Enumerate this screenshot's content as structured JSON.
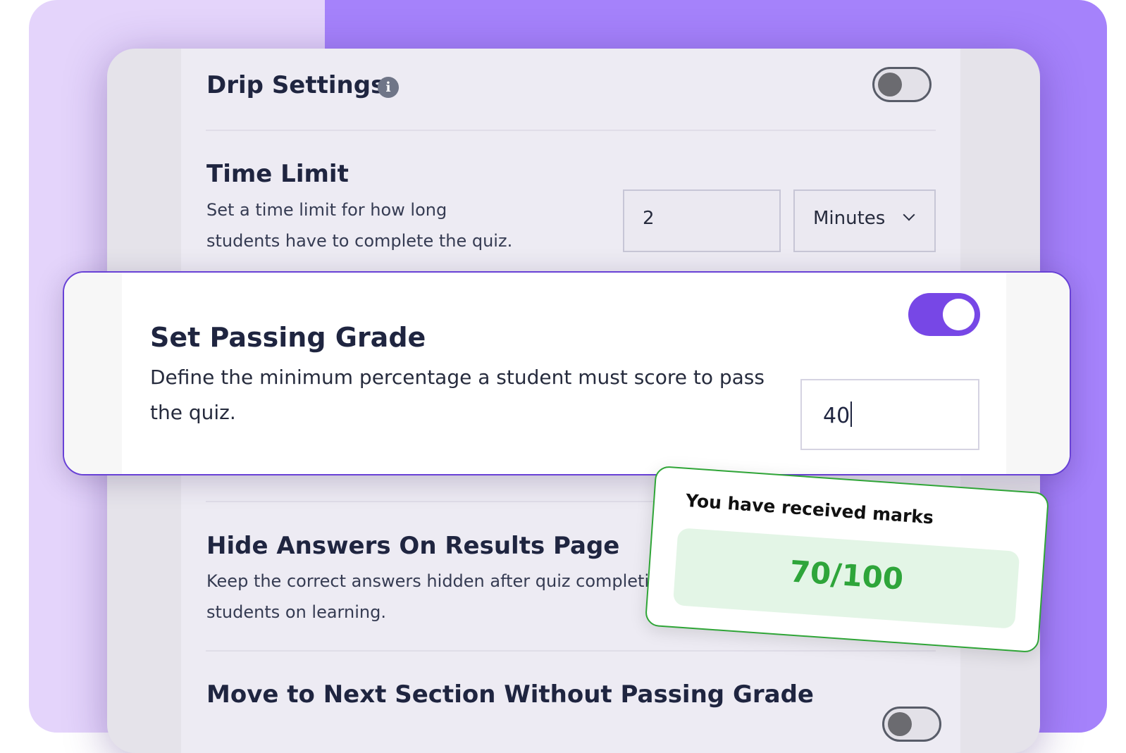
{
  "drip": {
    "title": "Drip Settings",
    "info_icon": "info-icon",
    "enabled": false
  },
  "time_limit": {
    "title": "Time Limit",
    "description": "Set a time limit for how long students have to complete the quiz.",
    "value": "2",
    "unit": "Minutes",
    "unit_icon": "chevron-down-icon"
  },
  "passing_grade": {
    "title": "Set Passing Grade",
    "description": "Define the minimum percentage a student must score to pass the quiz.",
    "value": "40",
    "enabled": true
  },
  "hide_answers": {
    "title": "Hide Answers On Results Page",
    "description": "Keep the correct answers hidden after quiz completion to focus students on learning."
  },
  "next_section": {
    "title": "Move to Next Section Without Passing Grade"
  },
  "result_card": {
    "label": "You have received marks",
    "score": "70/100"
  },
  "colors": {
    "accent": "#7747e6",
    "success": "#2ea53a",
    "background": "#a582fb"
  }
}
